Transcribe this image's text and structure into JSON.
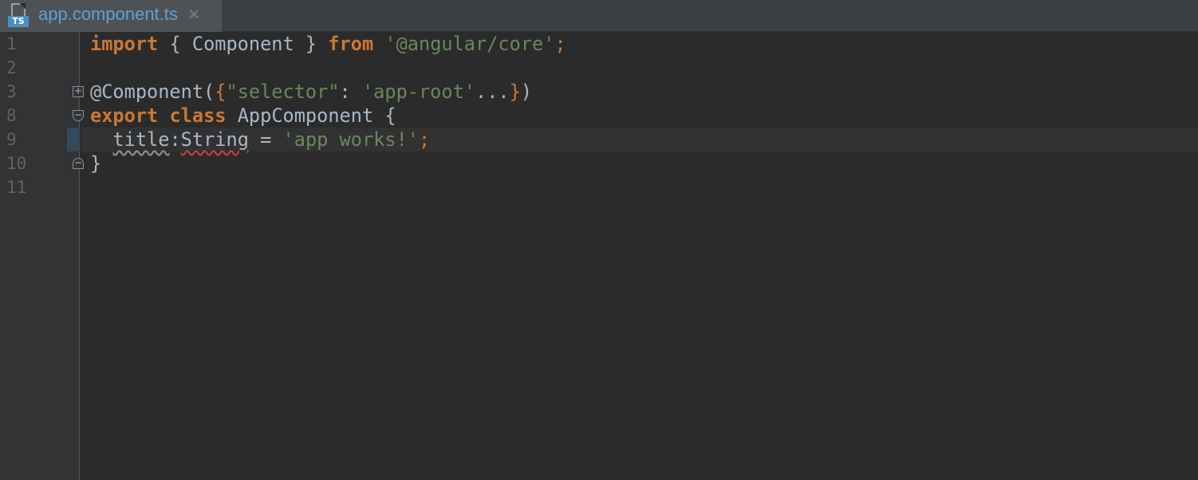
{
  "tab": {
    "file_icon_badge": "TS",
    "title": "app.component.ts",
    "close_glyph": "✕"
  },
  "gutter": {
    "line_numbers": [
      "1",
      "2",
      "3",
      "8",
      "9",
      "10",
      "11"
    ],
    "fold_expand_glyph": "+",
    "fold_collapse_glyph": "−"
  },
  "code": {
    "line1": {
      "kw_import": "import",
      "open": " { ",
      "name": "Component",
      "close": " } ",
      "kw_from": "from",
      "space": " ",
      "module": "'@angular/core'",
      "semi": ";"
    },
    "line3": {
      "decorator": "@Component(",
      "brace_open": "{",
      "key": "\"selector\"",
      "colon": ": ",
      "value": "'app-root'",
      "ellipsis": "...",
      "brace_close": "}",
      "paren_close": ")"
    },
    "line8": {
      "kw_export": "export",
      "kw_class": "class",
      "class_name": "AppComponent",
      "brace": "{"
    },
    "line9": {
      "indent": "  ",
      "prop": "title",
      "colon": ":",
      "type": "String",
      "eq": " = ",
      "value": "'app works!'",
      "semi": ";"
    },
    "line10": {
      "brace": "}"
    }
  },
  "colors": {
    "keyword": "#cc7832",
    "string": "#6a8759",
    "default_text": "#a9b7c6",
    "tab_title": "#5fa1d7",
    "ts_badge": "#4a8fc0",
    "error_underline": "#bc3f3c"
  }
}
